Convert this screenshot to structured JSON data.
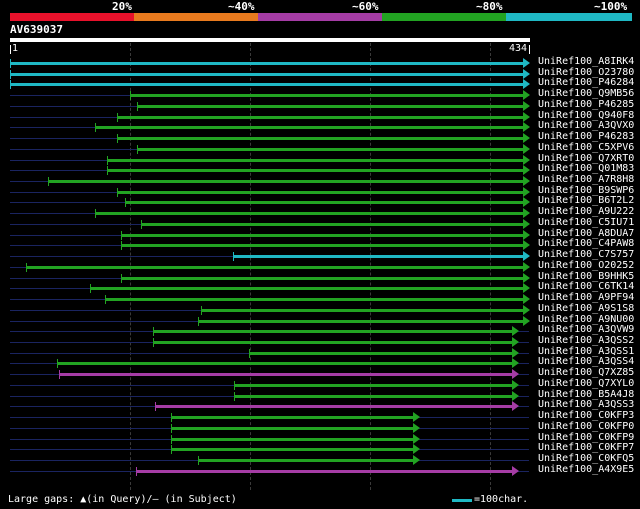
{
  "header": {
    "percent_labels": [
      "20%",
      "~40%",
      "~60%",
      "~80%",
      "~100%"
    ],
    "band_colors": [
      "#e8112b",
      "#e87a1e",
      "#a53ca5",
      "#22a322",
      "#1fb8c4"
    ],
    "query_name": "AV639037",
    "scale_start": "1",
    "scale_end": "434"
  },
  "hits": [
    {
      "id": "UniRef100_A8IRK4",
      "color": "#1fb8c4",
      "start": 1,
      "end": 434
    },
    {
      "id": "UniRef100_O23780",
      "color": "#1fb8c4",
      "start": 1,
      "end": 434
    },
    {
      "id": "UniRef100_P46284",
      "color": "#1fb8c4",
      "start": 1,
      "end": 434
    },
    {
      "id": "UniRef100_Q9MB56",
      "color": "#22a322",
      "start": 101,
      "end": 434
    },
    {
      "id": "UniRef100_P46285",
      "color": "#22a322",
      "start": 107,
      "end": 434
    },
    {
      "id": "UniRef100_Q940F8",
      "color": "#22a322",
      "start": 90,
      "end": 434
    },
    {
      "id": "UniRef100_A3QVX0",
      "color": "#22a322",
      "start": 72,
      "end": 434
    },
    {
      "id": "UniRef100_P46283",
      "color": "#22a322",
      "start": 90,
      "end": 434
    },
    {
      "id": "UniRef100_C5XPV6",
      "color": "#22a322",
      "start": 107,
      "end": 434
    },
    {
      "id": "UniRef100_Q7XRT0",
      "color": "#22a322",
      "start": 82,
      "end": 434
    },
    {
      "id": "UniRef100_Q01M83",
      "color": "#22a322",
      "start": 82,
      "end": 434
    },
    {
      "id": "UniRef100_A7R8H8",
      "color": "#22a322",
      "start": 33,
      "end": 434
    },
    {
      "id": "UniRef100_B9SWP6",
      "color": "#22a322",
      "start": 90,
      "end": 434
    },
    {
      "id": "UniRef100_B6T2L2",
      "color": "#22a322",
      "start": 97,
      "end": 434
    },
    {
      "id": "UniRef100_A9U222",
      "color": "#22a322",
      "start": 72,
      "end": 434
    },
    {
      "id": "UniRef100_C5IU71",
      "color": "#22a322",
      "start": 110,
      "end": 434
    },
    {
      "id": "UniRef100_A8DUA7",
      "color": "#22a322",
      "start": 94,
      "end": 434
    },
    {
      "id": "UniRef100_C4PAW8",
      "color": "#22a322",
      "start": 94,
      "end": 434
    },
    {
      "id": "UniRef100_C7S757",
      "color": "#1fb8c4",
      "start": 187,
      "end": 434
    },
    {
      "id": "UniRef100_O20252",
      "color": "#22a322",
      "start": 14,
      "end": 434
    },
    {
      "id": "UniRef100_B9HHK5",
      "color": "#22a322",
      "start": 94,
      "end": 434
    },
    {
      "id": "UniRef100_C6TK14",
      "color": "#22a322",
      "start": 68,
      "end": 434
    },
    {
      "id": "UniRef100_A9PF94",
      "color": "#22a322",
      "start": 80,
      "end": 434
    },
    {
      "id": "UniRef100_A9S1S8",
      "color": "#22a322",
      "start": 160,
      "end": 434
    },
    {
      "id": "UniRef100_A9NU00",
      "color": "#22a322",
      "start": 158,
      "end": 434
    },
    {
      "id": "UniRef100_A3QVW9",
      "color": "#22a322",
      "start": 120,
      "end": 425
    },
    {
      "id": "UniRef100_A3QSS2",
      "color": "#22a322",
      "start": 120,
      "end": 425
    },
    {
      "id": "UniRef100_A3QSS1",
      "color": "#22a322",
      "start": 200,
      "end": 425
    },
    {
      "id": "UniRef100_A3QSS4",
      "color": "#22a322",
      "start": 40,
      "end": 425
    },
    {
      "id": "UniRef100_Q7XZ85",
      "color": "#a53ca5",
      "start": 42,
      "end": 425
    },
    {
      "id": "UniRef100_Q7XYL0",
      "color": "#22a322",
      "start": 188,
      "end": 425
    },
    {
      "id": "UniRef100_B5A4J8",
      "color": "#22a322",
      "start": 188,
      "end": 425
    },
    {
      "id": "UniRef100_A3QSS3",
      "color": "#a53ca5",
      "start": 122,
      "end": 425
    },
    {
      "id": "UniRef100_C0KFP3",
      "color": "#22a322",
      "start": 135,
      "end": 342
    },
    {
      "id": "UniRef100_C0KFP0",
      "color": "#22a322",
      "start": 135,
      "end": 342
    },
    {
      "id": "UniRef100_C0KFP9",
      "color": "#22a322",
      "start": 135,
      "end": 342
    },
    {
      "id": "UniRef100_C0KFP7",
      "color": "#22a322",
      "start": 135,
      "end": 342
    },
    {
      "id": "UniRef100_C0KFQ5",
      "color": "#22a322",
      "start": 158,
      "end": 342
    },
    {
      "id": "UniRef100_A4X9E5",
      "color": "#a53ca5",
      "start": 106,
      "end": 425
    }
  ],
  "footer": {
    "legend_text": "Large gaps: ▲(in Query)/– (in Subject)",
    "scale_text": "=100char."
  }
}
